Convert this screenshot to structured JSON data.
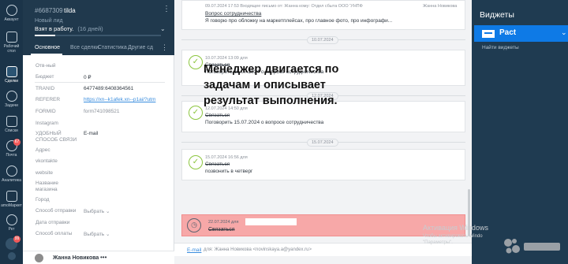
{
  "nav": {
    "items": [
      {
        "label": "Аккаунт",
        "icon": "account-icon"
      },
      {
        "label": "Рабочий стол",
        "icon": "dashboard-icon"
      },
      {
        "label": "Сделки",
        "icon": "deals-icon"
      },
      {
        "label": "Задачи",
        "icon": "tasks-icon"
      },
      {
        "label": "Списки",
        "icon": "lists-icon"
      },
      {
        "label": "Почта",
        "icon": "mail-icon",
        "badge": "67"
      },
      {
        "label": "Аналитика",
        "icon": "analytics-icon"
      },
      {
        "label": "amoМаркет",
        "icon": "market-icon"
      },
      {
        "label": "Ркт",
        "icon": "widget-icon"
      }
    ],
    "bottom_badge": "99"
  },
  "card": {
    "lead_id": "#6687309",
    "lead_name": "tilda",
    "new_lead": "Новый лид",
    "stage": "Взят в работу.",
    "stage_days": "(16 дней)",
    "stage_progress": 0.16,
    "tabs": [
      "Основное",
      "Все сделки",
      "Статистика",
      "Другие сд"
    ],
    "fields": [
      {
        "label": "Отв-ный",
        "value": ""
      },
      {
        "label": "Бюджет",
        "value": "0 ₽"
      },
      {
        "label": "TRANID",
        "value": "6477489:6408364561"
      },
      {
        "label": "REFERER",
        "value": "https://xn--k1afek.xn--p1ai/?utm"
      },
      {
        "label": "FORMID",
        "value": "form741098521"
      },
      {
        "label": "Instagram",
        "value": ""
      },
      {
        "label": "УДОБНЫЙ СПОСОБ СВЯЗИ",
        "value": "E-mail"
      },
      {
        "label": "Адрес",
        "value": ""
      },
      {
        "label": "vkontakte",
        "value": ""
      },
      {
        "label": "website",
        "value": ""
      },
      {
        "label": "Название магазина",
        "value": ""
      },
      {
        "label": "Город",
        "value": ""
      },
      {
        "label": "Способ отправки",
        "value": "Выбрать"
      },
      {
        "label": "Дата отправки",
        "value": ""
      },
      {
        "label": "Способ оплаты",
        "value": "Выбрать"
      }
    ],
    "footer_name": "Жанна Новикова"
  },
  "feed": {
    "top_note": {
      "meta": "09.07.2024 17:53 Входящее письмо от: Жанна кому: Отдел сбыта ООО 'УНПФ",
      "author": "Жанна Новикова",
      "subject": "Вопрос сотрудничества",
      "preview": "Я говорю про обложку на маркетплейсах, про главное фото, про инфографи..."
    },
    "dates": [
      "10.07.2024",
      "12.07.2024",
      "15.07.2024"
    ],
    "tasks": [
      {
        "meta": "10.07.2024 13:09  для",
        "title": "Связаться",
        "text": "Поговорить 15.07.2024 о вопросе сотрудничества"
      },
      {
        "meta": "12.07.2024 14:50  для",
        "title": "Связаться",
        "text": "Поговорить 15.07.2024 о вопросе сотрудничества"
      },
      {
        "meta": "15.07.2024 16:56  для",
        "title": "Связаться",
        "text": "позвонить в четверг"
      }
    ],
    "open_task": {
      "meta": "22.07.2024  для",
      "title": "Связаться"
    },
    "overlay": "Менеджер двигается по задачам и описывает результат выполнения.",
    "email_bar": {
      "label": "E-mail",
      "to": "для: Жанна Новикова <novinskaya.a@yandex.ru>"
    }
  },
  "widgets": {
    "title": "Виджеты",
    "tile_name": "Pact",
    "link": "Найти виджеты"
  },
  "windows": {
    "title": "Активация Windows",
    "text": "Чтобы активировать Windo\n\"Параметры\"."
  },
  "colors": {
    "nav_bg": "#1b3449",
    "card_head": "#20394d",
    "check_green": "#8cc63f",
    "overdue_red": "#f7a8a8",
    "widget_blue": "#0e7ae6"
  }
}
